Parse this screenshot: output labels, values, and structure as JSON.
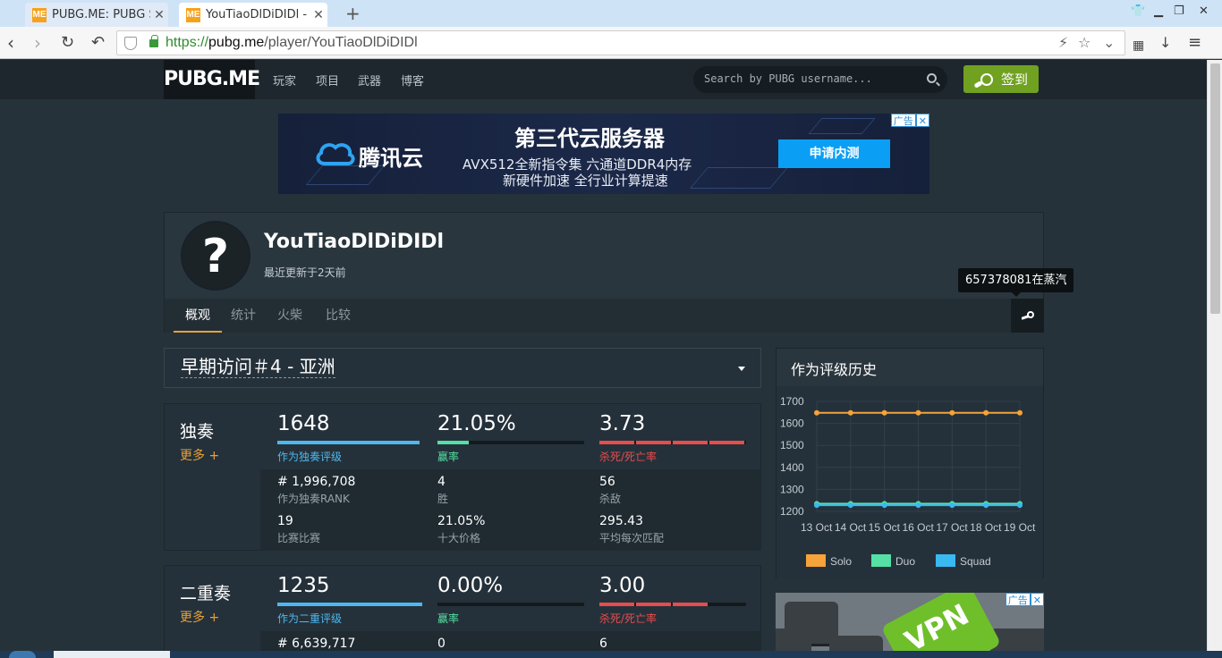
{
  "browser": {
    "tabs": [
      {
        "favicon": "ME",
        "title": "PUBG.ME: PUBG S"
      },
      {
        "favicon": "ME",
        "title": "YouTiaoDlDiDIDl -"
      }
    ],
    "new_tab_symbol": "+",
    "close_symbol": "✕",
    "url_scheme": "https://",
    "url_host": "pubg.me",
    "url_path": "/player/YouTiaoDlDiDIDl"
  },
  "site": {
    "logo": "PUBG.ME",
    "menu": [
      "玩家",
      "项目",
      "武器",
      "博客"
    ],
    "search_placeholder": "Search by PUBG username...",
    "signin_label": "签到"
  },
  "ad_top": {
    "brand": "腾讯云",
    "title": "第三代云服务器",
    "line1": "AVX512全新指令集 六通道DDR4内存",
    "line2": "新硬件加速 全行业计算提速",
    "cta": "申请内测",
    "tag": "广告",
    "tag_close": "✕"
  },
  "profile": {
    "avatar_symbol": "?",
    "name": "YouTiaoDlDiDIDl",
    "updated": "最近更新于2天前",
    "tabs": [
      "概观",
      "统计",
      "火柴",
      "比较"
    ],
    "steam_tooltip": "657378081在蒸汽"
  },
  "season": {
    "label": "早期访问＃4 - 亚洲"
  },
  "modes": [
    {
      "name": "独奏",
      "more": "更多 +",
      "rating": "1648",
      "rating_label": "作为独奏评级",
      "rating_pct": 1.0,
      "winrate": "21.05%",
      "winrate_label": "赢率",
      "winrate_pct": 0.2105,
      "kd": "3.73",
      "kd_label": "杀死/死亡率",
      "kd_segments": 4,
      "rank": "# 1,996,708",
      "rank_label": "作为独奏RANK",
      "wins": "4",
      "wins_label": "胜",
      "kills": "56",
      "kills_label": "杀敌",
      "matches": "19",
      "matches_label": "比赛比赛",
      "top10": "21.05%",
      "top10_label": "十大价格",
      "avg_damage": "295.43",
      "avg_damage_label": "平均每次匹配"
    },
    {
      "name": "二重奏",
      "more": "更多 +",
      "rating": "1235",
      "rating_label": "作为二重评级",
      "rating_pct": 1.0,
      "winrate": "0.00%",
      "winrate_label": "赢率",
      "winrate_pct": 0,
      "kd": "3.00",
      "kd_label": "杀死/死亡率",
      "kd_segments": 3,
      "rank": "# 6,639,717",
      "wins": "0",
      "kills": "6"
    }
  ],
  "chart": {
    "title": "作为评级历史"
  },
  "chart_data": {
    "type": "line",
    "title": "作为评级历史",
    "categories": [
      "13 Oct",
      "14 Oct",
      "15 Oct",
      "16 Oct",
      "17 Oct",
      "18 Oct",
      "19 Oct"
    ],
    "x_tick_labels": [
      "13 Oct",
      "14 Oct",
      "15 Oct",
      "16 Oct",
      "17 Oct",
      "18 Oct",
      "19 Oct"
    ],
    "y_ticks": [
      1200,
      1300,
      1400,
      1500,
      1600,
      1700
    ],
    "ylim": [
      1200,
      1700
    ],
    "grid": true,
    "legend_position": "bottom",
    "series": [
      {
        "name": "Solo",
        "color": "#f5a33a",
        "values": [
          1648,
          1648,
          1648,
          1648,
          1648,
          1648,
          1648
        ]
      },
      {
        "name": "Duo",
        "color": "#55e0a5",
        "values": [
          1235,
          1235,
          1235,
          1235,
          1235,
          1235,
          1235
        ]
      },
      {
        "name": "Squad",
        "color": "#3ab8f0",
        "values": [
          1228,
          1228,
          1228,
          1228,
          1228,
          1228,
          1228
        ]
      }
    ]
  },
  "side_ad": {
    "tag": "广告",
    "tag_close": "✕",
    "key_text": "VPN"
  },
  "colors": {
    "accent_orange": "#e8a13a",
    "rating_bar": "#4db8f0",
    "winrate_bar": "#55e0a5",
    "kd_bar": "#e84c4c",
    "signin_green": "#71a121"
  }
}
